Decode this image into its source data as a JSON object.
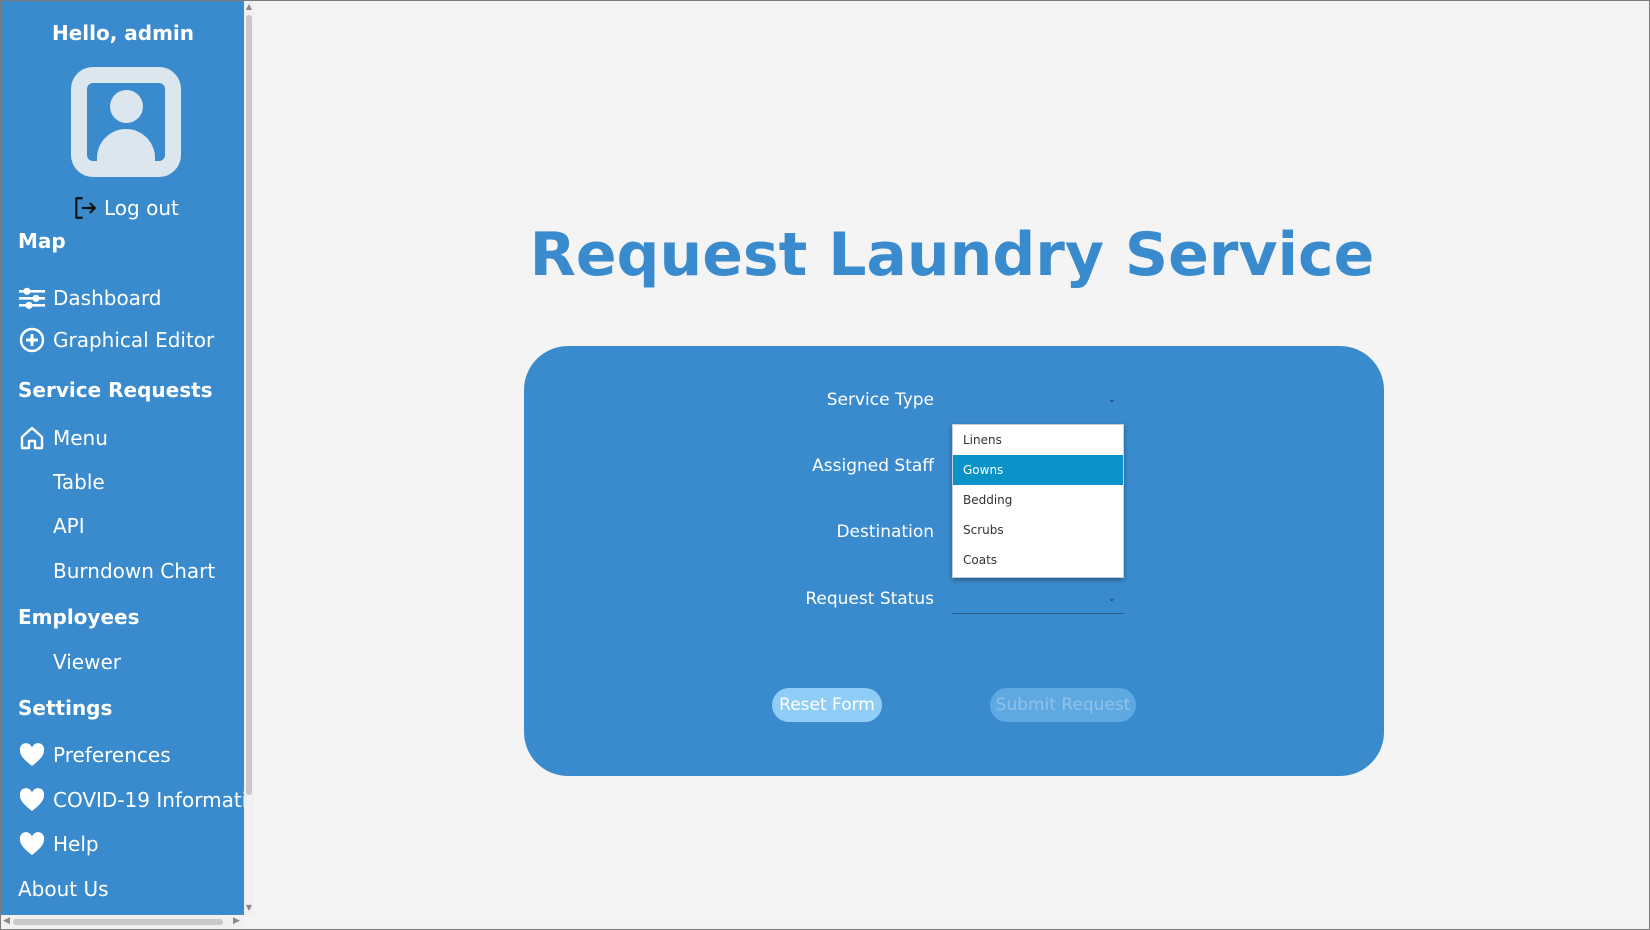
{
  "sidebar": {
    "greeting": "Hello, admin",
    "logout_label": "Log out",
    "sections": {
      "map": "Map",
      "service_requests": "Service Requests",
      "employees": "Employees",
      "settings": "Settings"
    },
    "items": {
      "dashboard": "Dashboard",
      "graphical_editor": "Graphical Editor",
      "menu": "Menu",
      "table": "Table",
      "api": "API",
      "burndown_chart": "Burndown Chart",
      "viewer": "Viewer",
      "preferences": "Preferences",
      "covid": "COVID-19 Informati...",
      "help": "Help",
      "about_us": "About Us"
    },
    "icons": {
      "dashboard": "sliders-icon",
      "graphical_editor": "plus-circle-icon",
      "menu": "home-icon",
      "preferences": "heart-icon",
      "covid": "heart-icon",
      "help": "heart-icon",
      "logout": "logout-icon"
    }
  },
  "main": {
    "title": "Request Laundry Service",
    "form": {
      "service_type_label": "Service Type",
      "assigned_staff_label": "Assigned Staff",
      "destination_label": "Destination",
      "request_status_label": "Request Status",
      "service_type_options": [
        "Linens",
        "Gowns",
        "Bedding",
        "Scrubs",
        "Coats"
      ],
      "service_type_highlighted": "Gowns",
      "reset_label": "Reset Form",
      "submit_label": "Submit Request"
    }
  },
  "colors": {
    "accent": "#3a8bcd",
    "background": "#f4f4f5",
    "dropdown_highlight": "#0a93c9"
  }
}
